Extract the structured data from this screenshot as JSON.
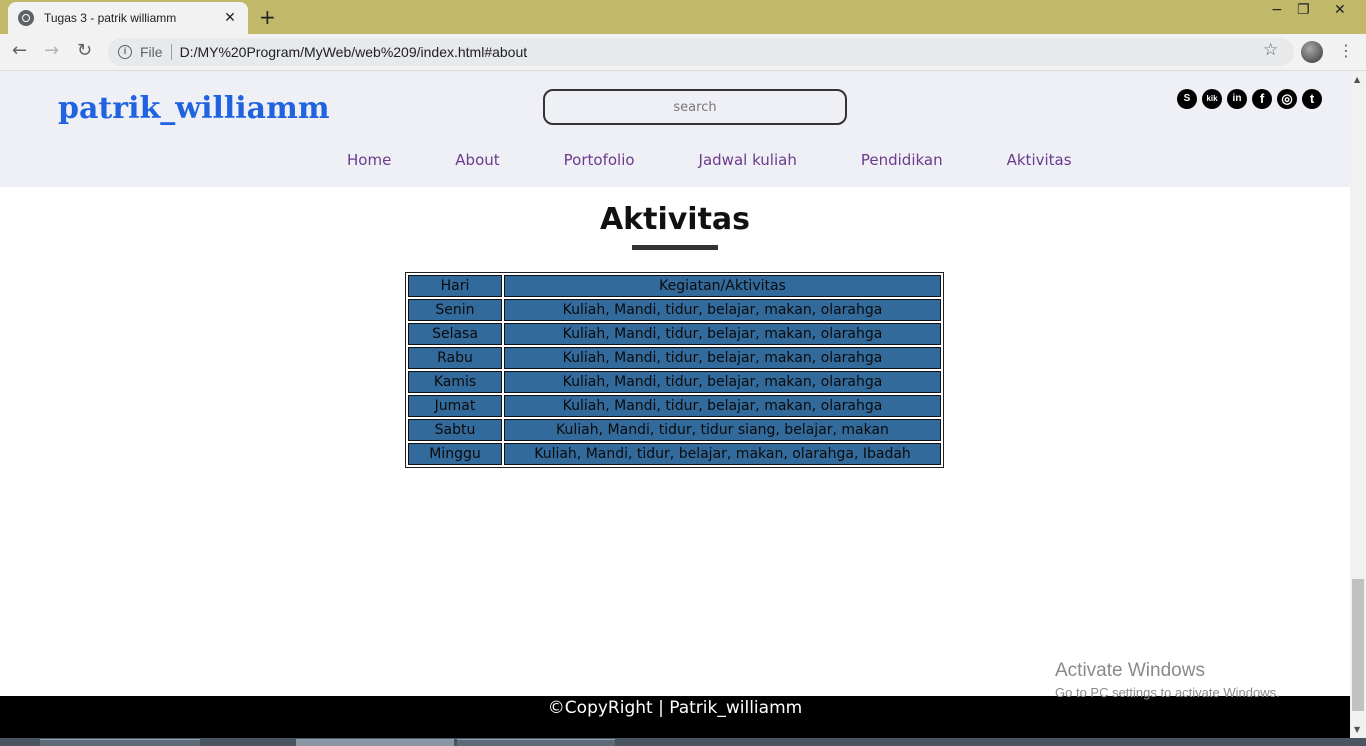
{
  "browser": {
    "tab_title": "Tugas 3 - patrik williamm",
    "tab_close": "✕",
    "new_tab": "+",
    "minimize": "−",
    "restore": "❐",
    "close": "✕",
    "back": "←",
    "forward": "→",
    "reload": "↻",
    "info": "i",
    "file_label": "File",
    "url": "D:/MY%20Program/MyWeb/web%209/index.html#about",
    "star": "☆",
    "menu": "⋮"
  },
  "site": {
    "brand": "patrik_williamm",
    "search_placeholder": "search",
    "social": [
      {
        "icon": "skype-icon",
        "glyph": "S"
      },
      {
        "icon": "kik-icon",
        "glyph": "kik"
      },
      {
        "icon": "linkedin-icon",
        "glyph": "in"
      },
      {
        "icon": "facebook-icon",
        "glyph": "f"
      },
      {
        "icon": "instagram-icon",
        "glyph": "◎"
      },
      {
        "icon": "tumblr-icon",
        "glyph": "t"
      }
    ],
    "nav": [
      "Home",
      "About",
      "Portofolio",
      "Jadwal kuliah",
      "Pendidikan",
      "Aktivitas"
    ]
  },
  "section": {
    "title": "Aktivitas",
    "table": {
      "headers": [
        "Hari",
        "Kegiatan/Aktivitas"
      ],
      "rows": [
        [
          "Senin",
          "Kuliah, Mandi, tidur, belajar, makan, olarahga"
        ],
        [
          "Selasa",
          "Kuliah, Mandi, tidur, belajar, makan, olarahga"
        ],
        [
          "Rabu",
          "Kuliah, Mandi, tidur, belajar, makan, olarahga"
        ],
        [
          "Kamis",
          "Kuliah, Mandi, tidur, belajar, makan, olarahga"
        ],
        [
          "Jumat",
          "Kuliah, Mandi, tidur, belajar, makan, olarahga"
        ],
        [
          "Sabtu",
          "Kuliah, Mandi, tidur, tidur siang, belajar, makan"
        ],
        [
          "Minggu",
          "Kuliah, Mandi, tidur, belajar, makan, olarahga, Ibadah"
        ]
      ]
    }
  },
  "footer": {
    "text": "©CopyRight | Patrik_williamm"
  },
  "watermark": {
    "line1": "Activate Windows",
    "line2": "Go to PC settings to activate Windows."
  },
  "colors": {
    "brand": "#1f63e0",
    "nav": "#6b3a8c",
    "table_cell": "#336a9c",
    "chrome": "#c2b86a"
  }
}
